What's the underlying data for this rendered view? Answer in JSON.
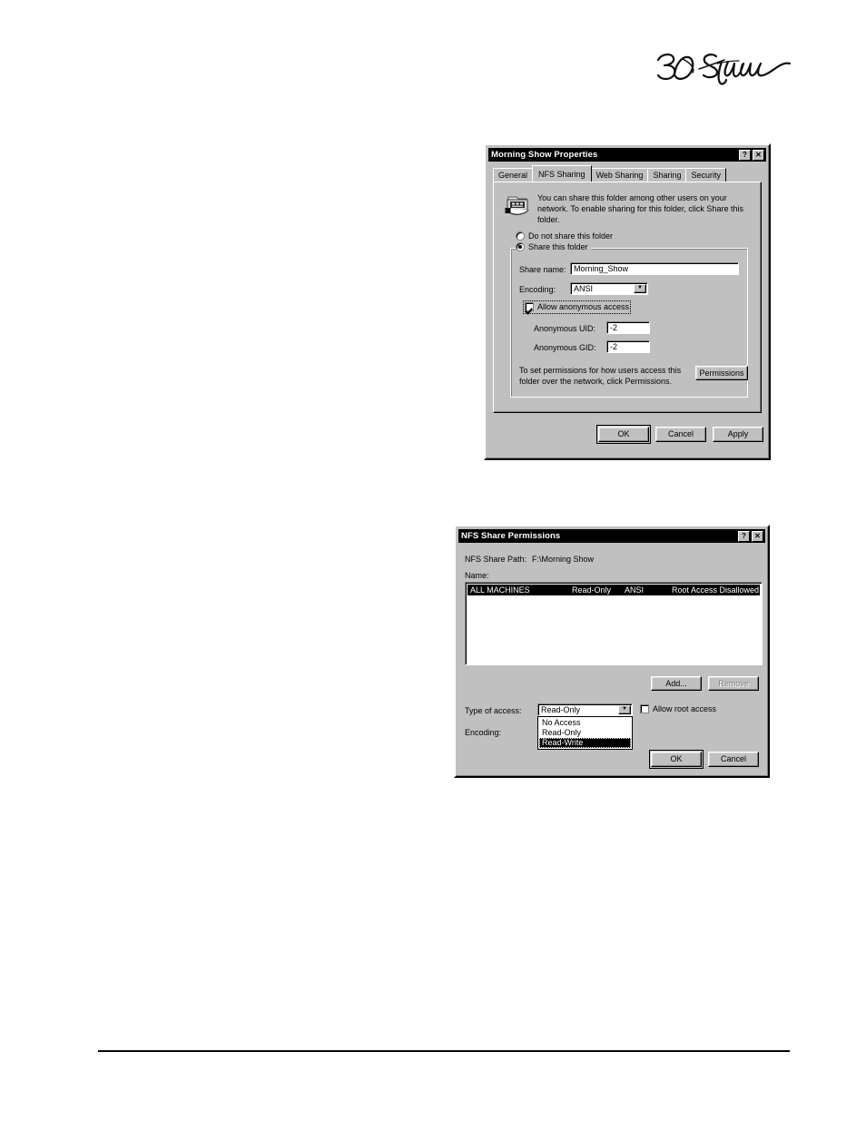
{
  "page": {
    "background": "#ffffff",
    "logo_text": "360 Systems",
    "logo_name": "360-systems-logo"
  },
  "properties_dialog": {
    "title": "Morning Show Properties",
    "help_button": "?",
    "close_button": "✕",
    "tabs": [
      {
        "label": "General",
        "active": false
      },
      {
        "label": "NFS Sharing",
        "active": true
      },
      {
        "label": "Web Sharing",
        "active": false
      },
      {
        "label": "Sharing",
        "active": false
      },
      {
        "label": "Security",
        "active": false
      }
    ],
    "info_text": "You can share this folder among other users on your network. To enable sharing for this folder, click Share this folder.",
    "icon_name": "network-share-folder-icon",
    "radio_no_share": {
      "label": "Do not share this folder",
      "selected": false
    },
    "radio_share": {
      "label": "Share this folder",
      "selected": true
    },
    "share_name_label": "Share name:",
    "share_name_value": "Morning_Show",
    "encoding_label": "Encoding:",
    "encoding_value": "ANSI",
    "allow_anonymous": {
      "label": "Allow anonymous access",
      "checked": true
    },
    "anon_uid_label": "Anonymous UID:",
    "anon_uid_value": "-2",
    "anon_gid_label": "Anonymous GID:",
    "anon_gid_value": "-2",
    "permissions_help": "To set permissions for how users access this folder over the network, click Permissions.",
    "permissions_button": "Permissions",
    "ok_button": "OK",
    "cancel_button": "Cancel",
    "apply_button": "Apply"
  },
  "permissions_dialog": {
    "title": "NFS Share Permissions",
    "help_button": "?",
    "close_button": "✕",
    "share_path_label": "NFS Share Path:",
    "share_path_value": "F:\\Morning Show",
    "name_label": "Name:",
    "list_rows": [
      {
        "name": "ALL MACHINES",
        "access": "Read-Only",
        "encoding": "ANSI",
        "root": "Root Access Disallowed",
        "selected": true
      }
    ],
    "add_button": "Add...",
    "remove_button": "Remove",
    "remove_disabled": true,
    "type_of_access_label": "Type of access:",
    "type_of_access_value": "Read-Only",
    "type_of_access_options": [
      {
        "label": "No Access",
        "selected": false
      },
      {
        "label": "Read-Only",
        "selected": false
      },
      {
        "label": "Read-Write",
        "selected": true
      }
    ],
    "dropdown_open": true,
    "encoding_label": "Encoding:",
    "allow_root_access": {
      "label": "Allow root access",
      "checked": false
    },
    "ok_button": "OK",
    "cancel_button": "Cancel"
  }
}
